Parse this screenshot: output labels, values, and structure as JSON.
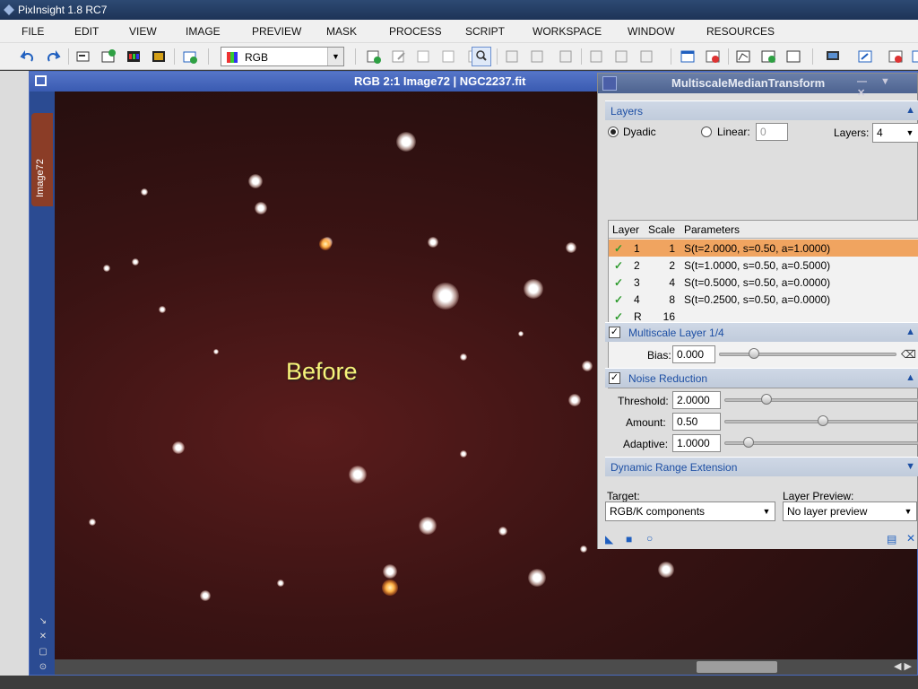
{
  "app": {
    "title": "PixInsight 1.8 RC7"
  },
  "menu": [
    "FILE",
    "EDIT",
    "VIEW",
    "IMAGE",
    "PREVIEW",
    "MASK",
    "PROCESS",
    "SCRIPT",
    "WORKSPACE",
    "WINDOW",
    "RESOURCES"
  ],
  "toolbar": {
    "channel_select": "RGB"
  },
  "image_window": {
    "title": "RGB 2:1 Image72 | NGC2237.fit",
    "tab_label": "Image72",
    "overlay_text": "Before"
  },
  "dialog": {
    "title": "MultiscaleMedianTransform",
    "layers_section": "Layers",
    "dyadic_label": "Dyadic",
    "linear_label": "Linear:",
    "linear_value": "0",
    "layers_label": "Layers:",
    "layers_value": "4",
    "table": {
      "headers": [
        "Layer",
        "Scale",
        "Parameters"
      ],
      "rows": [
        {
          "layer": "1",
          "scale": "1",
          "params": "S(t=2.0000, s=0.50, a=1.0000)"
        },
        {
          "layer": "2",
          "scale": "2",
          "params": "S(t=1.0000, s=0.50, a=0.5000)"
        },
        {
          "layer": "3",
          "scale": "4",
          "params": "S(t=0.5000, s=0.50, a=0.0000)"
        },
        {
          "layer": "4",
          "scale": "8",
          "params": "S(t=0.2500, s=0.50, a=0.0000)"
        },
        {
          "layer": "R",
          "scale": "16",
          "params": ""
        }
      ]
    },
    "multiscale_layer_section": "Multiscale Layer 1/4",
    "bias_label": "Bias:",
    "bias_value": "0.000",
    "noise_section": "Noise Reduction",
    "threshold_label": "Threshold:",
    "threshold_value": "2.0000",
    "amount_label": "Amount:",
    "amount_value": "0.50",
    "adaptive_label": "Adaptive:",
    "adaptive_value": "1.0000",
    "dre_section": "Dynamic Range Extension",
    "target_label": "Target:",
    "target_value": "RGB/K components",
    "layer_preview_label": "Layer Preview:",
    "layer_preview_value": "No layer preview"
  }
}
